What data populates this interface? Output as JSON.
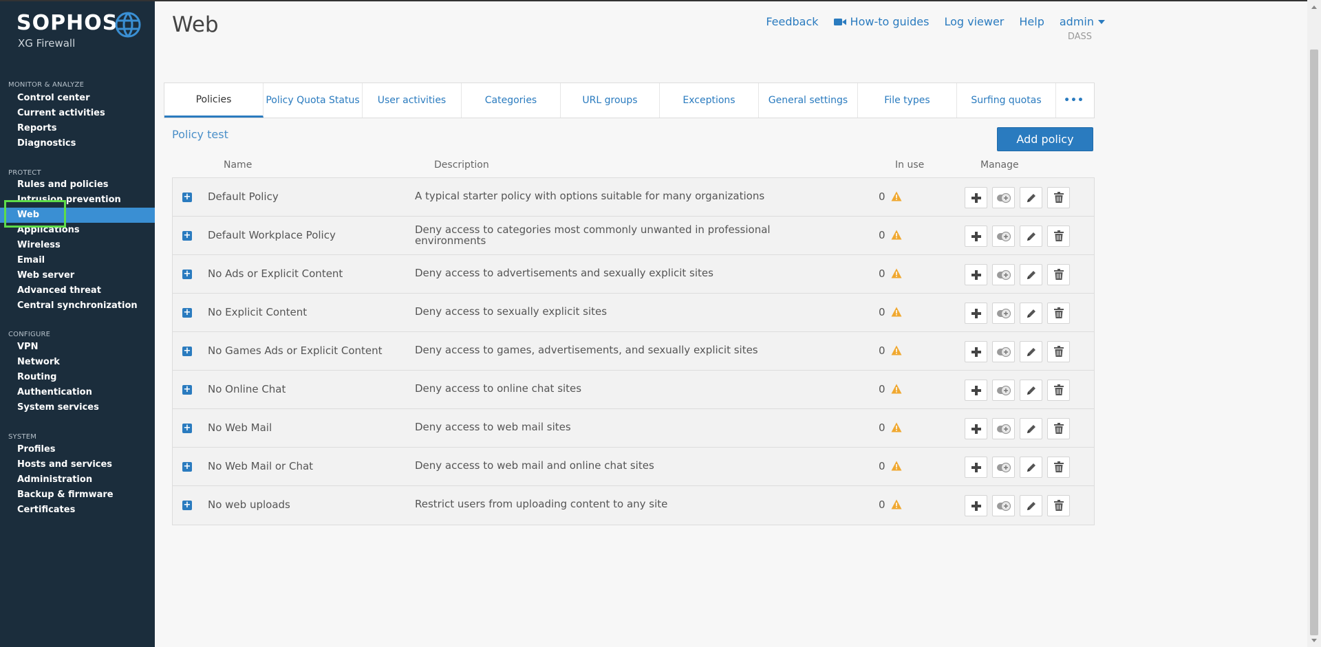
{
  "brand": {
    "name": "SOPHOS",
    "product": "XG Firewall"
  },
  "sidebar": {
    "sections": [
      {
        "title": "MONITOR & ANALYZE",
        "items": [
          "Control center",
          "Current activities",
          "Reports",
          "Diagnostics"
        ]
      },
      {
        "title": "PROTECT",
        "items": [
          "Rules and policies",
          "Intrusion prevention",
          "Web",
          "Applications",
          "Wireless",
          "Email",
          "Web server",
          "Advanced threat",
          "Central synchronization"
        ]
      },
      {
        "title": "CONFIGURE",
        "items": [
          "VPN",
          "Network",
          "Routing",
          "Authentication",
          "System services"
        ]
      },
      {
        "title": "SYSTEM",
        "items": [
          "Profiles",
          "Hosts and services",
          "Administration",
          "Backup & firmware",
          "Certificates"
        ]
      }
    ],
    "active_item": "Web"
  },
  "header": {
    "title": "Web",
    "links": {
      "feedback": "Feedback",
      "howto": "How-to guides",
      "logviewer": "Log viewer",
      "help": "Help",
      "user": "admin"
    },
    "user_sub": "DASS"
  },
  "tabs": [
    {
      "label": "Policies",
      "active": true
    },
    {
      "label": "Policy Quota Status"
    },
    {
      "label": "User activities"
    },
    {
      "label": "Categories"
    },
    {
      "label": "URL groups"
    },
    {
      "label": "Exceptions"
    },
    {
      "label": "General settings"
    },
    {
      "label": "File types"
    },
    {
      "label": "Surfing quotas"
    },
    {
      "label": "•••"
    }
  ],
  "policy_test_link": "Policy test",
  "add_policy_label": "Add policy",
  "table": {
    "columns": {
      "name": "Name",
      "description": "Description",
      "in_use": "In use",
      "manage": "Manage"
    },
    "rows": [
      {
        "name": "Default Policy",
        "description": "A typical starter policy with options suitable for many organizations",
        "in_use": "0"
      },
      {
        "name": "Default Workplace Policy",
        "description": "Deny access to categories most commonly unwanted in professional environments",
        "in_use": "0"
      },
      {
        "name": "No Ads or Explicit Content",
        "description": "Deny access to advertisements and sexually explicit sites",
        "in_use": "0"
      },
      {
        "name": "No Explicit Content",
        "description": "Deny access to sexually explicit sites",
        "in_use": "0"
      },
      {
        "name": "No Games Ads or Explicit Content",
        "description": "Deny access to games, advertisements, and sexually explicit sites",
        "in_use": "0"
      },
      {
        "name": "No Online Chat",
        "description": "Deny access to online chat sites",
        "in_use": "0"
      },
      {
        "name": "No Web Mail",
        "description": "Deny access to web mail sites",
        "in_use": "0"
      },
      {
        "name": "No Web Mail or Chat",
        "description": "Deny access to web mail and online chat sites",
        "in_use": "0"
      },
      {
        "name": "No web uploads",
        "description": "Restrict users from uploading content to any site",
        "in_use": "0"
      }
    ]
  },
  "colors": {
    "sidebar_bg": "#1b2d3c",
    "accent": "#2a7bbf",
    "active_nav": "#3a8fd3",
    "warning": "#f0a830",
    "highlight": "#5ddc4a"
  }
}
